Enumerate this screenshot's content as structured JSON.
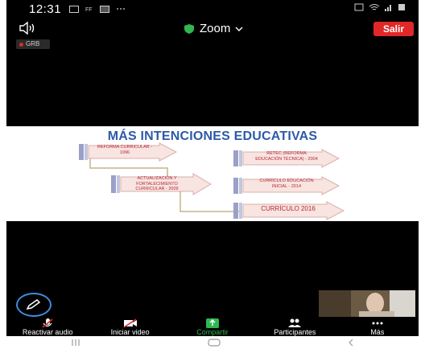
{
  "status_bar": {
    "time": "12:31"
  },
  "meeting_bar": {
    "title": "Zoom",
    "leave_label": "Salir"
  },
  "recording": {
    "label": "GRB"
  },
  "slide": {
    "title": "MÁS INTENCIONES EDUCATIVAS",
    "boxes": [
      "REFORMA CURRICULAR - 1996",
      "ACTUALIZACIÓN Y FORTALECIMIENTO CURRICULAR - 2009",
      "RETEC (REFORMA EDUCACIÓN TÉCNICA) - 2004",
      "CURRÍCULO EDUCACIÓN INICIAL - 2014",
      "CURRÍCULO 2016"
    ]
  },
  "toolbar": {
    "items": [
      {
        "label": "Reactivar audio",
        "icon": "muted-microphone-icon"
      },
      {
        "label": "Iniciar video",
        "icon": "video-off-icon"
      },
      {
        "label": "Compartir",
        "icon": "share-screen-icon"
      },
      {
        "label": "Participantes",
        "icon": "participants-icon"
      },
      {
        "label": "Más",
        "icon": "more-icon"
      }
    ]
  },
  "colors": {
    "leave": "#e02828",
    "share": "#2fb84d",
    "slide_title": "#2c5aa8",
    "box_text": "#b52a3a",
    "annotate_ring": "#3a8dde"
  }
}
